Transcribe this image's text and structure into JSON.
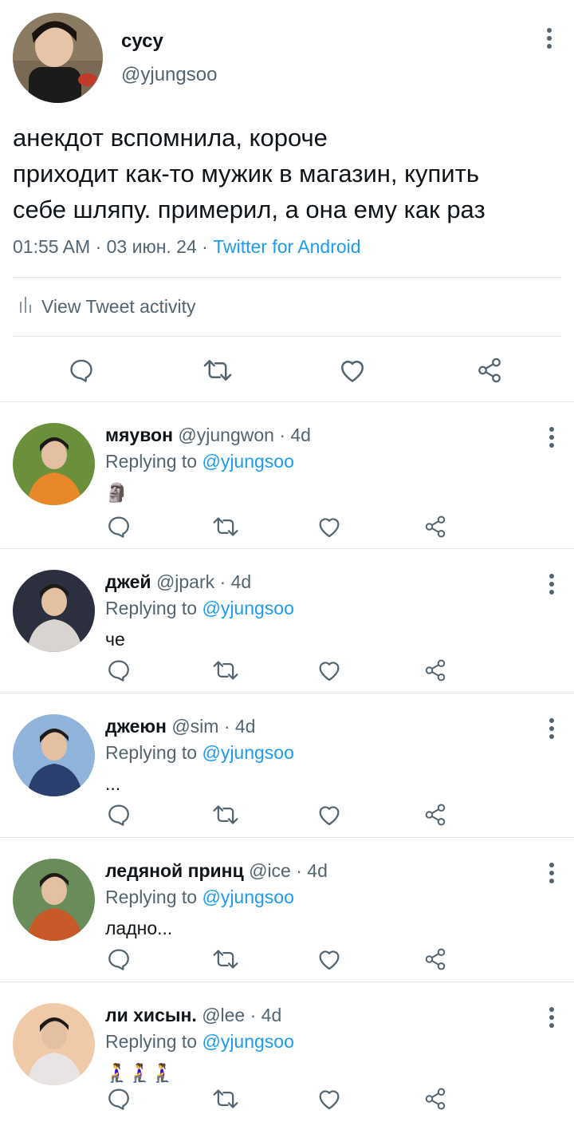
{
  "main_tweet": {
    "display_name": "сусу",
    "handle": "@yjungsoo",
    "text_lines": [
      "анекдот вспомнила, короче",
      "приходит как-то мужик в магазин, купить",
      "себе шляпу. примерил, а она ему как раз"
    ],
    "timestamp": "01:55 AM · 03 июн. 24 · ",
    "source": "Twitter for Android",
    "activity_label": "View Tweet activity",
    "icons": [
      "reply-icon",
      "retweet-icon",
      "like-icon",
      "share-icon"
    ]
  },
  "replies": [
    {
      "name": "мяувон",
      "handle": "@yjungwon",
      "time": " · 4d",
      "replying_prefix": "Replying to ",
      "replying_to": "@yjungsoo",
      "text": "🗿",
      "avatar_colors": [
        "#6b8f3a",
        "#e8882a"
      ]
    },
    {
      "name": "джей",
      "handle": "@jpark",
      "time": " · 4d",
      "replying_prefix": "Replying to ",
      "replying_to": "@yjungsoo",
      "text": "че",
      "avatar_colors": [
        "#2b2f3e",
        "#d9d4d0"
      ]
    },
    {
      "name": "джеюн",
      "handle": "@sim",
      "time": " · 4d",
      "replying_prefix": "Replying to ",
      "replying_to": "@yjungsoo",
      "text": "...",
      "avatar_colors": [
        "#8fb3d9",
        "#2a3f6e"
      ]
    },
    {
      "name": "ледяной принц",
      "handle": "@ice",
      "time": " · 4d",
      "replying_prefix": "Replying to ",
      "replying_to": "@yjungsoo",
      "text": "ладно...",
      "avatar_colors": [
        "#6a8c5a",
        "#c85a2a"
      ]
    },
    {
      "name": "ли хисын.",
      "handle": "@lee",
      "time": " · 4d",
      "replying_prefix": "Replying to ",
      "replying_to": "@yjungsoo",
      "text": "🧎‍♀️🧎‍♀️🧎‍♀️",
      "avatar_colors": [
        "#f0c9a8",
        "#e9e4e4"
      ]
    }
  ],
  "colors": {
    "text": "#0f1419",
    "secondary": "#536471",
    "accent": "#1d9bf0",
    "divider": "#e1e6ea"
  }
}
